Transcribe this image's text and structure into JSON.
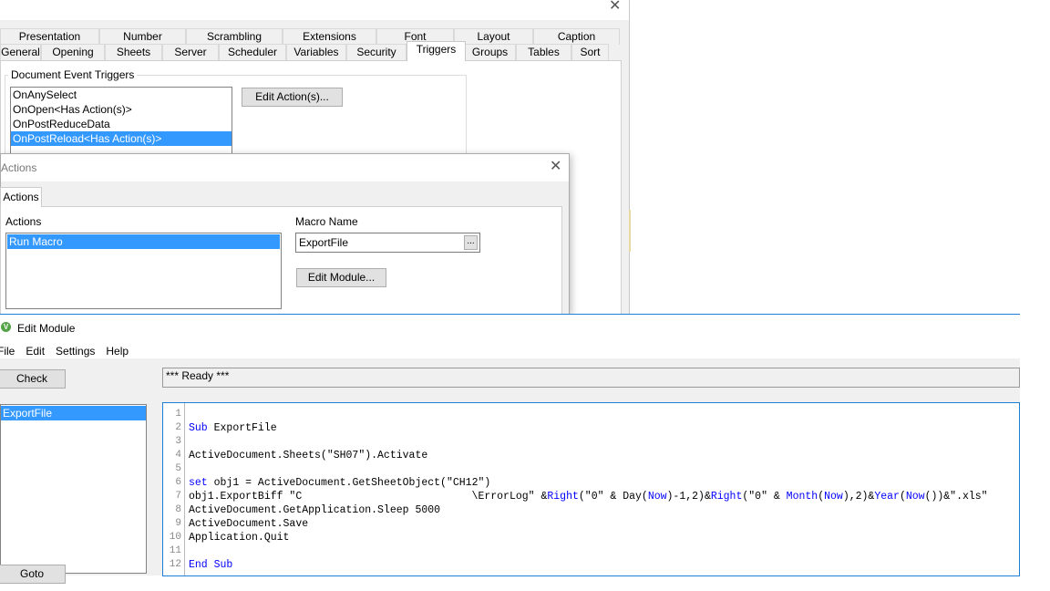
{
  "properties_dialog": {
    "close_icon": "close-icon",
    "tabs_row1": [
      "Presentation",
      "Number",
      "Scrambling",
      "Extensions",
      "Font",
      "Layout",
      "Caption"
    ],
    "tabs_row2": [
      "General",
      "Opening",
      "Sheets",
      "Server",
      "Scheduler",
      "Variables",
      "Security",
      "Triggers",
      "Groups",
      "Tables",
      "Sort"
    ],
    "active_tab": "Triggers",
    "group_title": "Document Event Triggers",
    "triggers": [
      "OnAnySelect",
      "OnOpen<Has Action(s)>",
      "OnPostReduceData",
      "OnPostReload<Has Action(s)>"
    ],
    "selected_trigger": "OnPostReload<Has Action(s)>",
    "edit_actions_label": "Edit Action(s)..."
  },
  "actions_dialog": {
    "title": "Actions",
    "tab": "Actions",
    "actions_label": "Actions",
    "actions": [
      "Run Macro"
    ],
    "macro_name_label": "Macro Name",
    "macro_name_value": "ExportFile",
    "browse_label": "...",
    "edit_module_label": "Edit Module..."
  },
  "edit_module": {
    "title": "Edit Module",
    "app_icon": "qlikview-icon",
    "accent_color": "#1e7fd6",
    "menu": [
      "File",
      "Edit",
      "Settings",
      "Help"
    ],
    "check_label": "Check",
    "status": "*** Ready ***",
    "modules": [
      "ExportFile"
    ],
    "goto_label": "Goto",
    "keyword_color": "#0000ff",
    "code_lines": [
      [],
      [
        {
          "t": "Sub",
          "k": 1
        },
        {
          "t": " ExportFile"
        }
      ],
      [],
      [
        {
          "t": "ActiveDocument.Sheets(\"SH07\").Activate"
        }
      ],
      [],
      [
        {
          "t": "set",
          "k": 1
        },
        {
          "t": " obj1 = ActiveDocument.GetSheetObject(\"CH12\")"
        }
      ],
      [
        {
          "t": "obj1.ExportBiff \"C                           \\ErrorLog\" &"
        },
        {
          "t": "Right",
          "k": 1
        },
        {
          "t": "(\"0\" & Day("
        },
        {
          "t": "Now",
          "k": 1
        },
        {
          "t": ")-1,2)&"
        },
        {
          "t": "Right",
          "k": 1
        },
        {
          "t": "(\"0\" & "
        },
        {
          "t": "Month",
          "k": 1
        },
        {
          "t": "("
        },
        {
          "t": "Now",
          "k": 1
        },
        {
          "t": "),2)&"
        },
        {
          "t": "Year",
          "k": 1
        },
        {
          "t": "("
        },
        {
          "t": "Now",
          "k": 1
        },
        {
          "t": "())&\".xls\""
        }
      ],
      [
        {
          "t": "ActiveDocument.GetApplication.Sleep 5000"
        }
      ],
      [
        {
          "t": "ActiveDocument.Save"
        }
      ],
      [
        {
          "t": "Application.Quit"
        }
      ],
      [],
      [
        {
          "t": "End Sub",
          "k": 1
        }
      ]
    ]
  }
}
